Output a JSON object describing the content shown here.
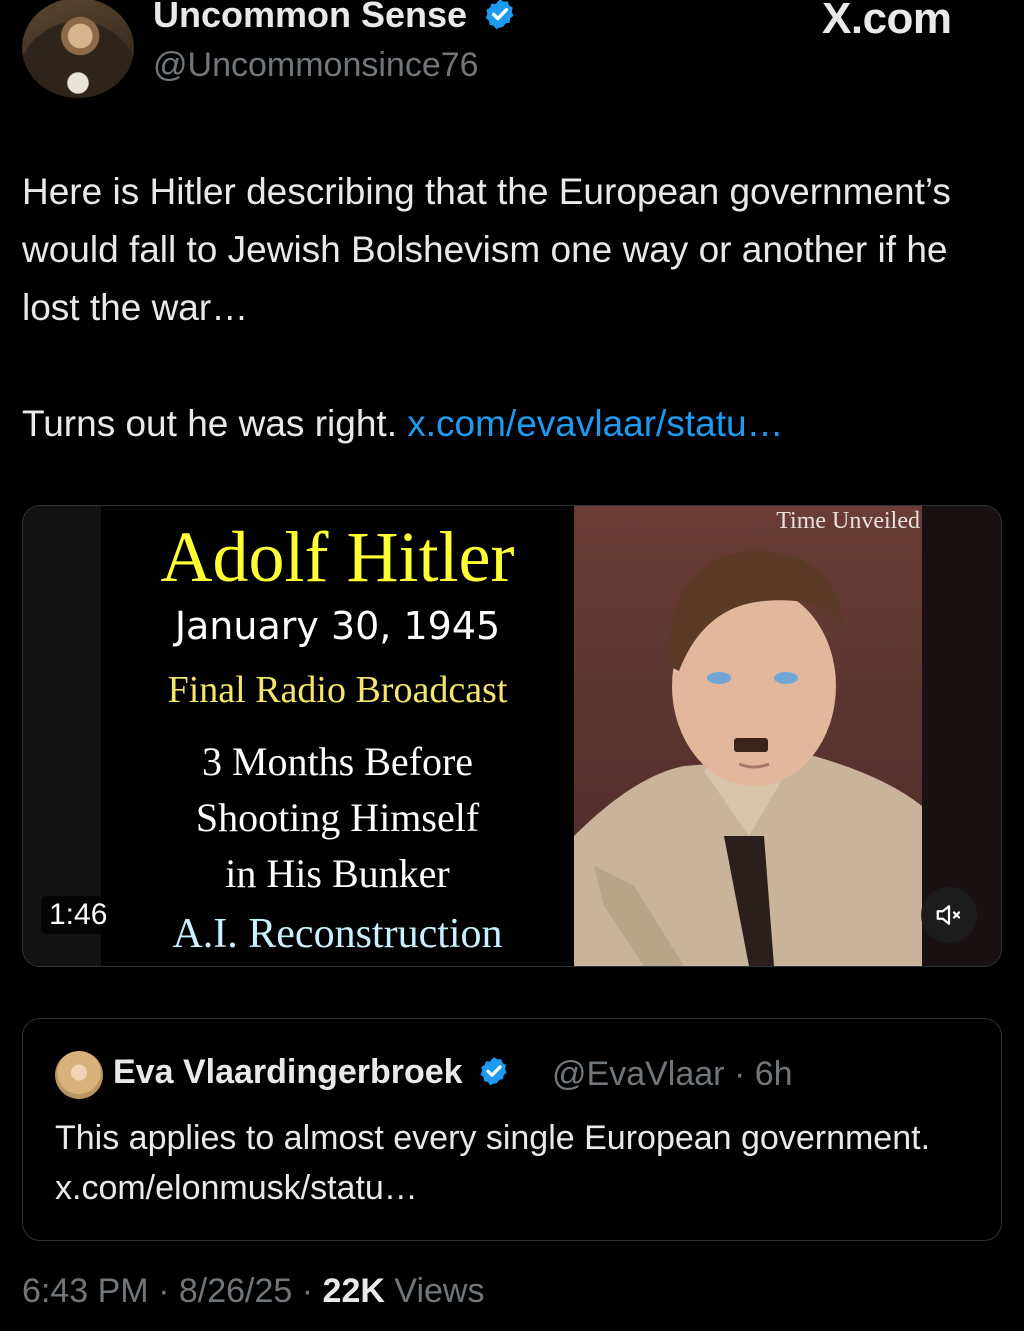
{
  "author": {
    "display_name": "Uncommon Sense",
    "handle": "@Uncommonsince76"
  },
  "watermark": "X.com",
  "tweet": {
    "text_line1": "Here is Hitler describing that the European government’s would fall to Jewish Bolshevism one way or another if he lost the war…",
    "text_line2_prefix": "Turns out he was right.",
    "link": "x.com/evavlaar/statu…"
  },
  "media": {
    "title": "Adolf Hitler",
    "date": "January 30, 1945",
    "broadcast": "Final Radio Broadcast",
    "sub1": "3 Months Before",
    "sub2": "Shooting Himself",
    "sub3": "in His Bunker",
    "ai": "A.I. Reconstruction",
    "channel": "Time Unveiled",
    "duration": "1:46"
  },
  "quote": {
    "name": "Eva Vlaardingerbroek",
    "handle": "@EvaVlaar",
    "sep": "·",
    "time": "6h",
    "text": "This applies to almost every single European government. x.com/elonmusk/statu…"
  },
  "footer": {
    "time": "6:43 PM",
    "sep1": "·",
    "date": "8/26/25",
    "sep2": "·",
    "views_count": "22K",
    "views_label": "Views"
  },
  "colors": {
    "background": "#000000",
    "link": "#1d9bf0",
    "verified": "#1d9bf0",
    "muted": "#71767b"
  }
}
